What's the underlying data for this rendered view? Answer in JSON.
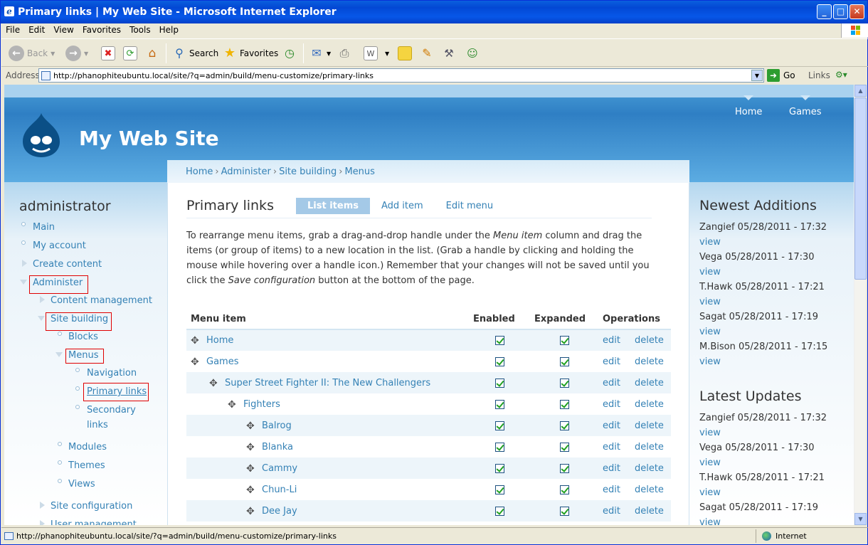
{
  "window": {
    "title": "Primary links | My Web Site - Microsoft Internet Explorer",
    "icon": "ie-icon"
  },
  "menubar": [
    "File",
    "Edit",
    "View",
    "Favorites",
    "Tools",
    "Help"
  ],
  "toolbar": {
    "back": "Back",
    "search": "Search",
    "favorites": "Favorites"
  },
  "address": {
    "label": "Address",
    "url": "http://phanophiteubuntu.local/site/?q=admin/build/menu-customize/primary-links",
    "go": "Go",
    "links": "Links"
  },
  "status": {
    "text": "http://phanophiteubuntu.local/site/?q=admin/build/menu-customize/primary-links",
    "zone": "Internet"
  },
  "site": {
    "name": "My Web Site",
    "nav": [
      "Home",
      "Games"
    ]
  },
  "breadcrumb": [
    "Home",
    "Administer",
    "Site building",
    "Menus"
  ],
  "page": {
    "title": "Primary links",
    "tabs": [
      "List items",
      "Add item",
      "Edit menu"
    ],
    "help": {
      "p1": "To rearrange menu items, grab a drag-and-drop handle under the ",
      "em1": "Menu item",
      "p2": " column and drag the items (or group of items) to a new location in the list. (Grab a handle by clicking and holding the mouse while hovering over a handle icon.) Remember that your changes will not be saved until you click the ",
      "em2": "Save configuration",
      "p3": " button at the bottom of the page."
    }
  },
  "table": {
    "headers": [
      "Menu item",
      "Enabled",
      "Expanded",
      "Operations"
    ],
    "edit": "edit",
    "delete": "delete",
    "rows": [
      {
        "label": "Home",
        "depth": 0
      },
      {
        "label": "Games",
        "depth": 0
      },
      {
        "label": "Super Street Fighter II: The New Challengers",
        "depth": 1
      },
      {
        "label": "Fighters",
        "depth": 2
      },
      {
        "label": "Balrog",
        "depth": 3
      },
      {
        "label": "Blanka",
        "depth": 3
      },
      {
        "label": "Cammy",
        "depth": 3
      },
      {
        "label": "Chun-Li",
        "depth": 3
      },
      {
        "label": "Dee Jay",
        "depth": 3
      }
    ]
  },
  "sidebar": {
    "title": "administrator",
    "items": {
      "main": "Main",
      "my_account": "My account",
      "create_content": "Create content",
      "administer": "Administer",
      "content_management": "Content management",
      "site_building": "Site building",
      "blocks": "Blocks",
      "menus": "Menus",
      "navigation": "Navigation",
      "primary_links": "Primary links",
      "secondary_links_1": "Secondary",
      "secondary_links_2": "links",
      "modules": "Modules",
      "themes": "Themes",
      "views": "Views",
      "site_configuration": "Site configuration",
      "user_management": "User management"
    }
  },
  "right": {
    "newest_title": "Newest Additions",
    "newest": [
      "Zangief 05/28/2011 - 17:32",
      "Vega 05/28/2011 - 17:30",
      "T.Hawk 05/28/2011 - 17:21",
      "Sagat 05/28/2011 - 17:19",
      "M.Bison 05/28/2011 - 17:15"
    ],
    "latest_title": "Latest Updates",
    "latest": [
      "Zangief 05/28/2011 - 17:32",
      "Vega 05/28/2011 - 17:30",
      "T.Hawk 05/28/2011 - 17:21",
      "Sagat 05/28/2011 - 17:19"
    ],
    "view": "view"
  },
  "colors": {
    "link": "#3481b5",
    "header": "#2f7fc4",
    "highlight_box": "#e00000"
  }
}
